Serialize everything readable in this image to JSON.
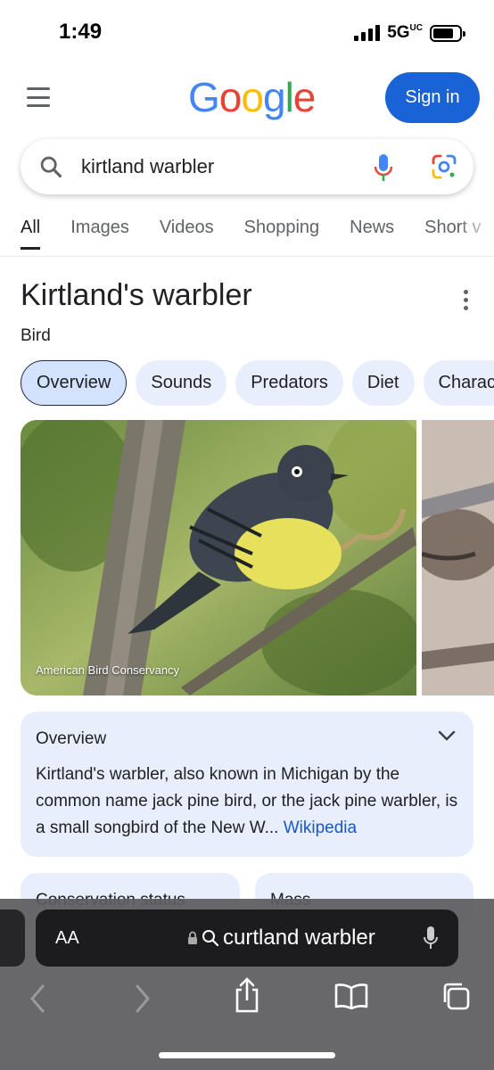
{
  "status_bar": {
    "time": "1:49",
    "network": "5G",
    "network_sub": "UC"
  },
  "header": {
    "logo_text": [
      "G",
      "o",
      "o",
      "g",
      "l",
      "e"
    ],
    "signin_label": "Sign in"
  },
  "search": {
    "query": "kirtland warbler"
  },
  "tabs": [
    {
      "label": "All",
      "active": true
    },
    {
      "label": "Images"
    },
    {
      "label": "Videos"
    },
    {
      "label": "Shopping"
    },
    {
      "label": "News"
    },
    {
      "label": "Short v"
    }
  ],
  "knowledge_panel": {
    "title": "Kirtland's warbler",
    "subtitle": "Bird",
    "chips": [
      "Overview",
      "Sounds",
      "Predators",
      "Diet",
      "Charac"
    ],
    "image_caption": "American Bird Conservancy",
    "overview": {
      "heading": "Overview",
      "text": "Kirtland's warbler, also known in Michigan by the common name jack pine bird, or the jack pine warbler, is a small songbird of the New W...",
      "link": "Wikipedia"
    },
    "facts": [
      {
        "label": "Conservation status"
      },
      {
        "label": "Mass"
      }
    ]
  },
  "safari": {
    "text_size_label": "AA",
    "address_text": "curtland warbler"
  },
  "colors": {
    "accent": "#1a63d6",
    "chip_bg": "#e8eefc",
    "link": "#1a56c7"
  }
}
